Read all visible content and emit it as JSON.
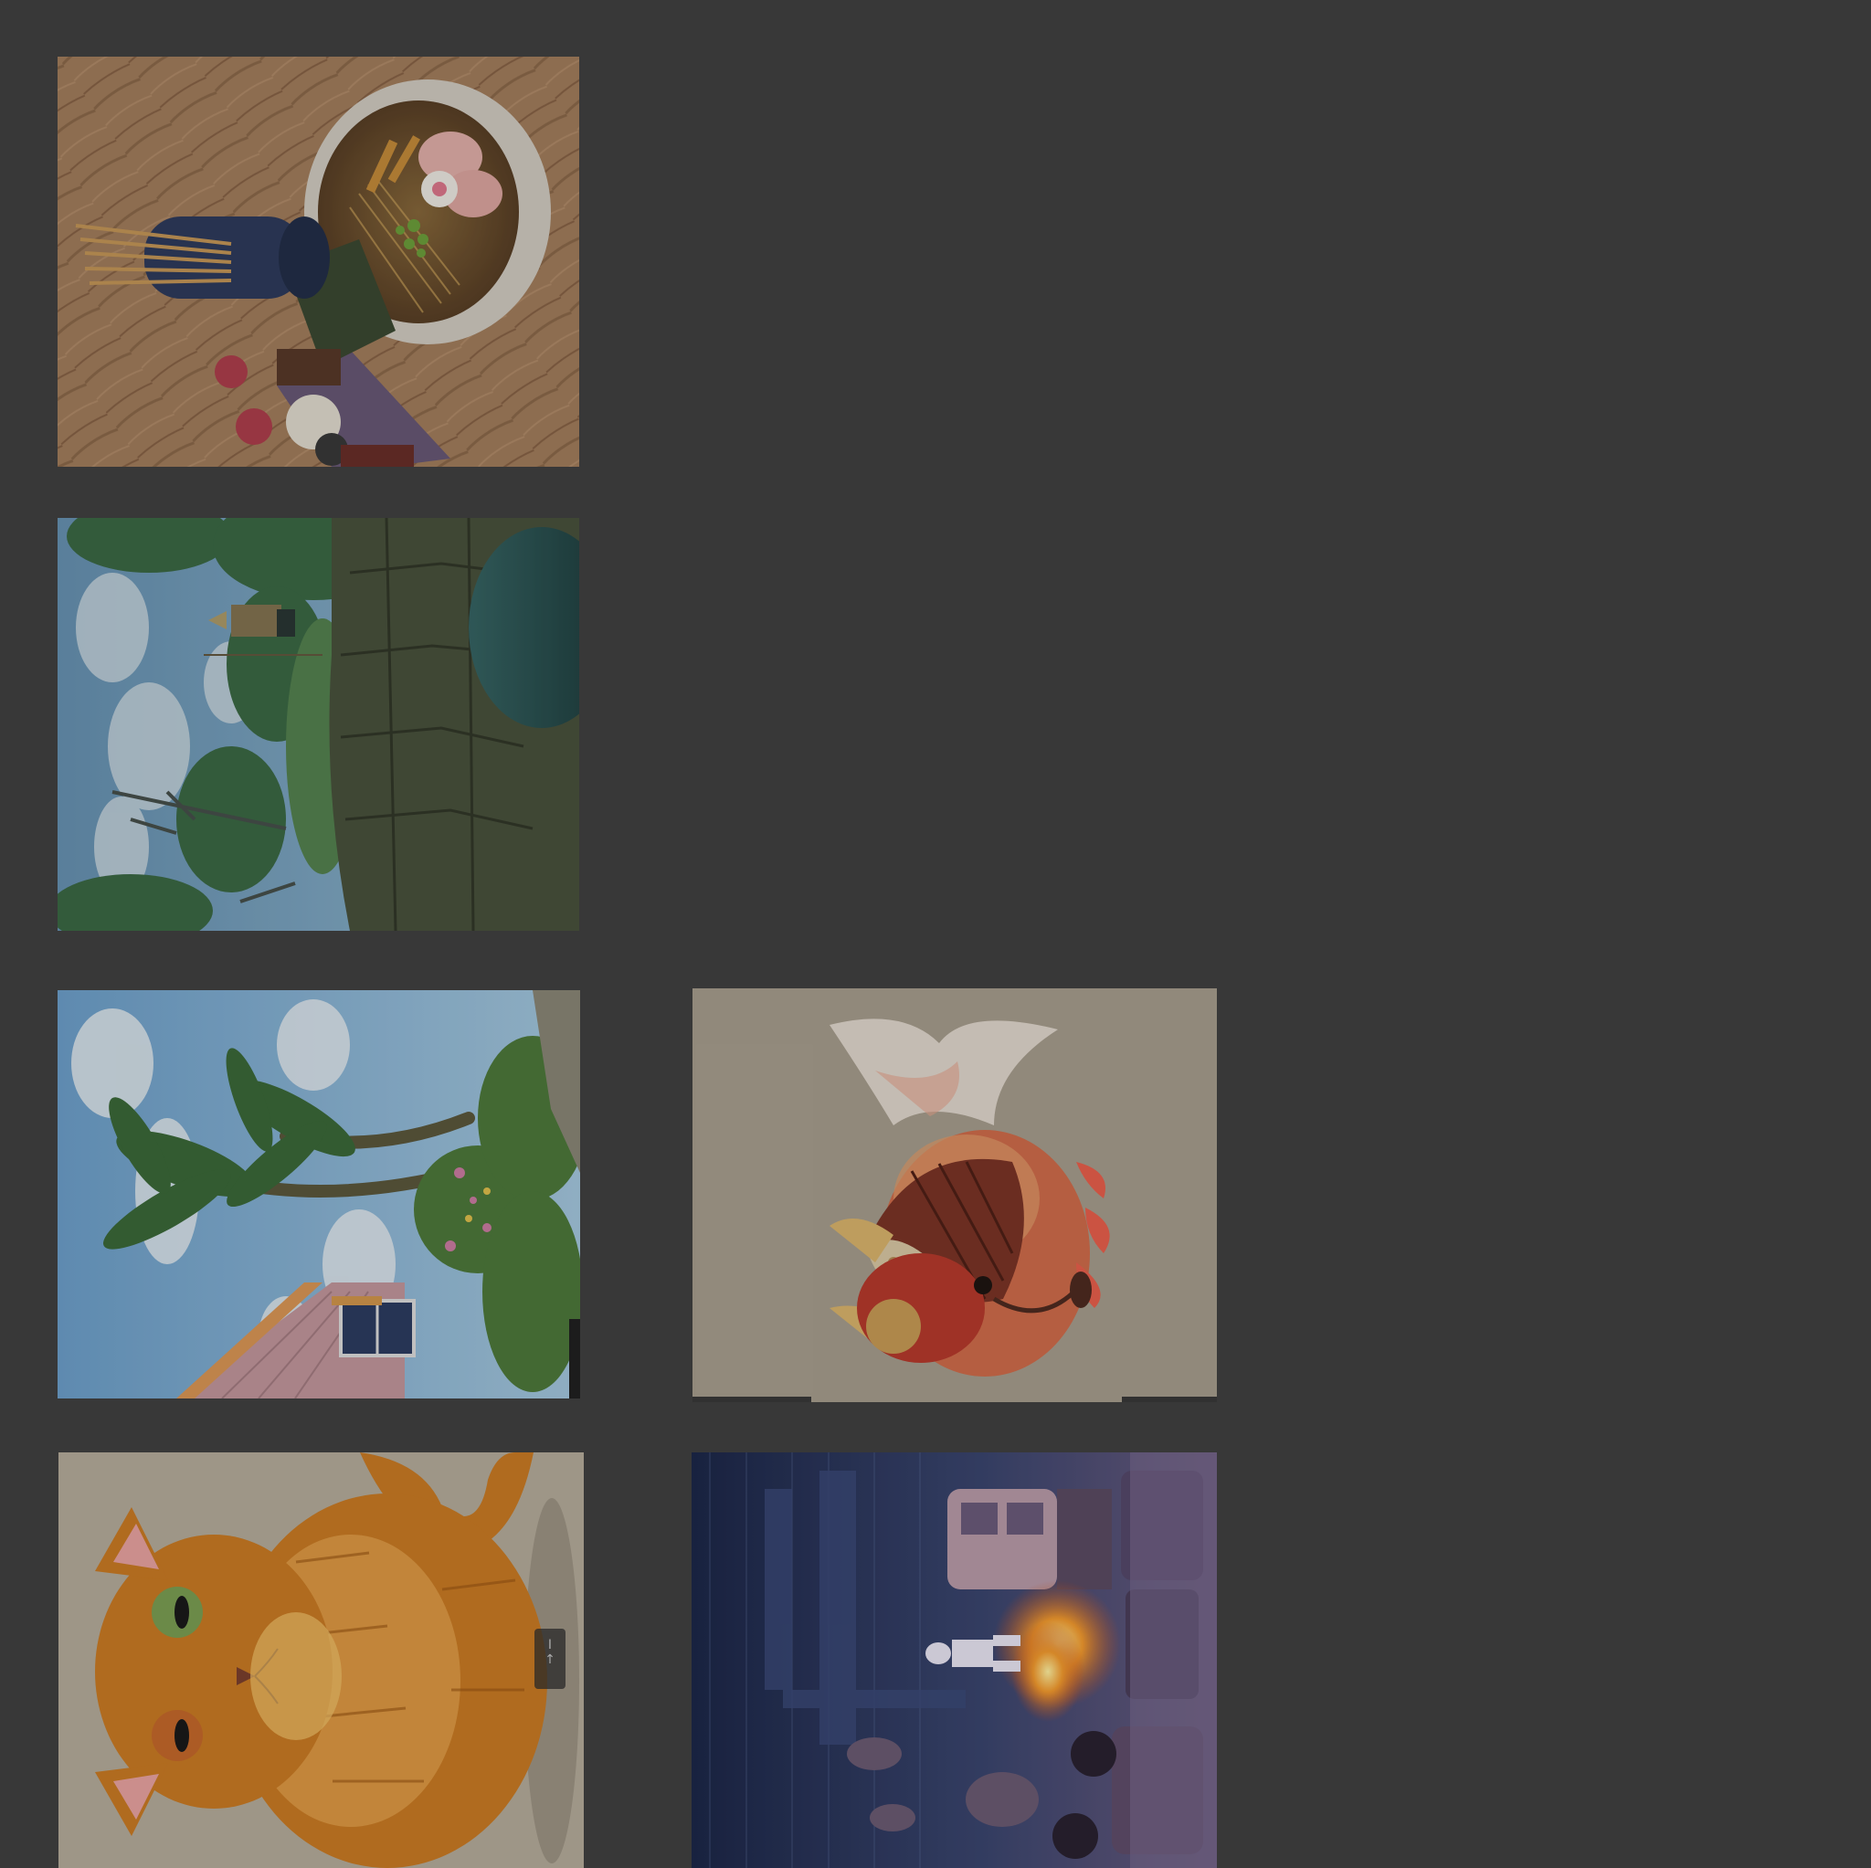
{
  "gallery": {
    "background": "#383838",
    "items": [
      {
        "subject": "ramen-bowl-table",
        "accent": "#b98a5e"
      },
      {
        "subject": "forest-stone-wall-traveler",
        "accent": "#5f8c5a"
      },
      {
        "subject": "tropical-palms-house",
        "accent": "#7fb2d6"
      },
      {
        "subject": "armored-goldfish",
        "accent": "#d4563a"
      },
      {
        "subject": "orange-cat",
        "accent": "#d88a2a"
      },
      {
        "subject": "night-city-van-fire",
        "accent": "#2d3f74"
      }
    ]
  }
}
